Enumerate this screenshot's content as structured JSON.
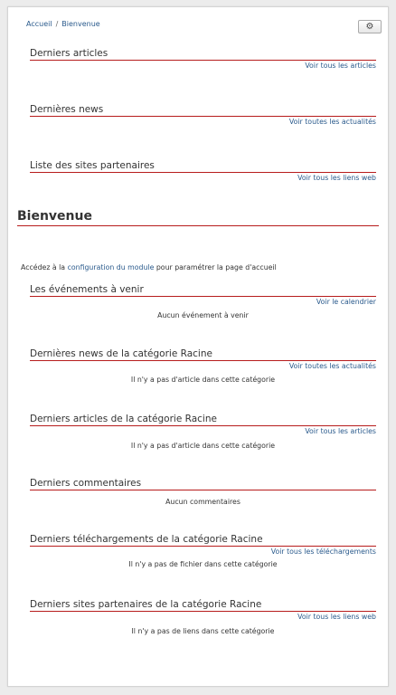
{
  "breadcrumb": {
    "home": "Accueil",
    "separator": "/",
    "current": "Bienvenue"
  },
  "top_sections": [
    {
      "title": "Derniers articles",
      "link": "Voir tous les articles"
    },
    {
      "title": "Dernières news",
      "link": "Voir toutes les actualités"
    },
    {
      "title": "Liste des sites partenaires",
      "link": "Voir tous les liens web"
    }
  ],
  "welcome": {
    "title": "Bienvenue",
    "intro_before": "Accédez à la ",
    "intro_link": "configuration du module",
    "intro_after": " pour paramétrer la page d'accueil"
  },
  "sections": [
    {
      "title": "Les événements à venir",
      "link": "Voir le calendrier",
      "empty": "Aucun événement à venir"
    },
    {
      "title": "Dernières news de la catégorie Racine",
      "link": "Voir toutes les actualités",
      "empty": "Il n'y a pas d'article dans cette catégorie"
    },
    {
      "title": "Derniers articles de la catégorie Racine",
      "link": "Voir tous les articles",
      "empty": "Il n'y a pas d'article dans cette catégorie"
    },
    {
      "title": "Derniers commentaires",
      "link": "",
      "empty": "Aucun commentaires"
    },
    {
      "title": "Derniers téléchargements de la catégorie Racine",
      "link": "Voir tous les téléchargements",
      "empty": "Il n'y a pas de fichier dans cette catégorie"
    },
    {
      "title": "Derniers sites partenaires de la catégorie Racine",
      "link": "Voir tous les liens web",
      "empty": "Il n'y a pas de liens dans cette catégorie"
    }
  ],
  "icons": {
    "settings": "gear-icon"
  },
  "colors": {
    "accent_line": "#b71c1c",
    "link": "#2a5a8c"
  }
}
